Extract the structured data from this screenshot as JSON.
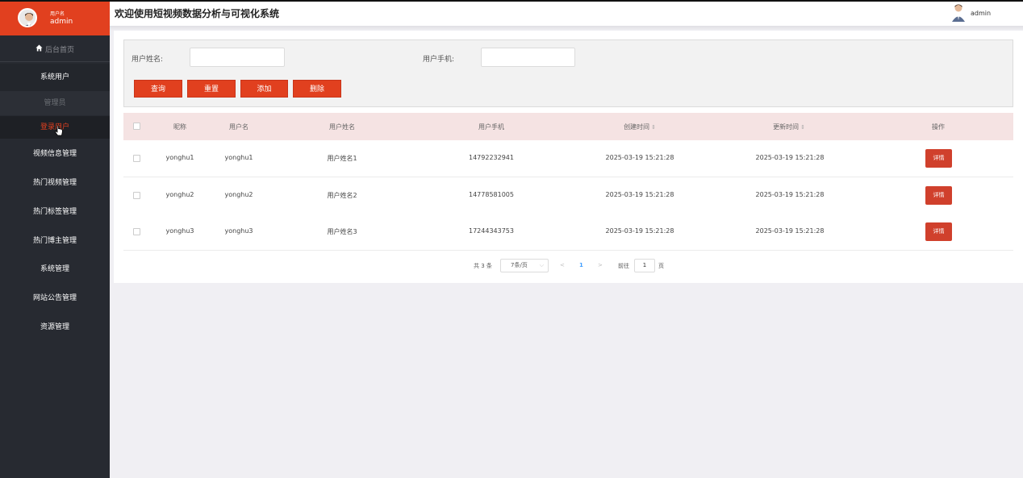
{
  "sidebar": {
    "user_label": "用户名",
    "user_name": "admin",
    "home": "后台首页",
    "system_user": "系统用户",
    "admin": "管理员",
    "login_user": "登录用户",
    "menu": [
      "视频信息管理",
      "热门视频管理",
      "热门标签管理",
      "热门博主管理",
      "系统管理",
      "网站公告管理",
      "资源管理"
    ]
  },
  "header": {
    "title": "欢迎使用短视频数据分析与可视化系统",
    "user": "admin"
  },
  "search": {
    "name_label": "用户姓名:",
    "phone_label": "用户手机:",
    "name_value": "",
    "phone_value": "",
    "buttons": {
      "query": "查询",
      "reset": "重置",
      "add": "添加",
      "delete": "删除"
    }
  },
  "table": {
    "columns": [
      "昵称",
      "用户名",
      "用户姓名",
      "用户手机",
      "创建时间",
      "更新时间",
      "操作"
    ],
    "rows": [
      {
        "nickname": "yonghu1",
        "username": "yonghu1",
        "realname": "用户姓名1",
        "phone": "14792232941",
        "created": "2025-03-19 15:21:28",
        "updated": "2025-03-19 15:21:28",
        "action": "详情"
      },
      {
        "nickname": "yonghu2",
        "username": "yonghu2",
        "realname": "用户姓名2",
        "phone": "14778581005",
        "created": "2025-03-19 15:21:28",
        "updated": "2025-03-19 15:21:28",
        "action": "详情"
      },
      {
        "nickname": "yonghu3",
        "username": "yonghu3",
        "realname": "用户姓名3",
        "phone": "17244343753",
        "created": "2025-03-19 15:21:28",
        "updated": "2025-03-19 15:21:28",
        "action": "详情"
      }
    ]
  },
  "pagination": {
    "total": "共 3 条",
    "page_size": "7条/页",
    "prev": "<",
    "current": "1",
    "next": ">",
    "goto_label": "前往",
    "goto_value": "1",
    "page_unit": "页"
  },
  "colors": {
    "accent": "#e1401f",
    "sidebar": "#272a31",
    "header_row": "#f5e3e3",
    "page_link": "#409eff"
  }
}
